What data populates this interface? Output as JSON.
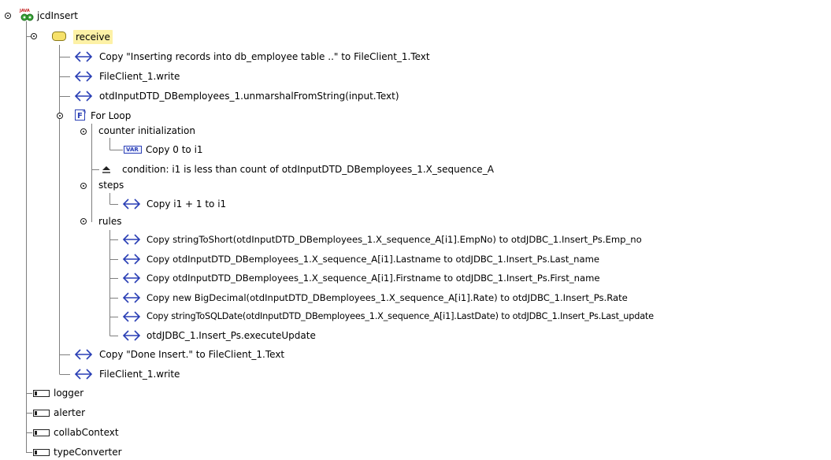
{
  "colors": {
    "tree_line": "#7f7f7f",
    "arrow_icon": "#2a3fb5",
    "folder_icon": "#f6e16a",
    "receive_highlight": "#fdf1a6"
  },
  "tree": {
    "root": {
      "label": "jcdInsert",
      "icon": "java-gear-icon"
    },
    "receive": {
      "label": "receive",
      "icon": "folder-icon"
    },
    "items": [
      {
        "label": "Copy \"Inserting records into db_employee table ..\" to FileClient_1.Text",
        "icon": "arrow-icon"
      },
      {
        "label": "FileClient_1.write",
        "icon": "arrow-icon"
      },
      {
        "label": "otdInputDTD_DBemployees_1.unmarshalFromString(input.Text)",
        "icon": "arrow-icon"
      }
    ],
    "for_loop": {
      "label": "For Loop",
      "icon": "for-loop-icon"
    },
    "counter_init": {
      "label": "counter initialization",
      "child": {
        "label": "Copy 0 to i1",
        "icon_text": "VAR"
      }
    },
    "condition": {
      "label": "condition: i1 is less than count of otdInputDTD_DBemployees_1.X_sequence_A",
      "icon": "condition-icon"
    },
    "steps": {
      "label": "steps",
      "child": {
        "label": "Copy i1 + 1 to i1",
        "icon": "arrow-icon"
      }
    },
    "rules": {
      "label": "rules",
      "children": [
        {
          "label": "Copy stringToShort(otdInputDTD_DBemployees_1.X_sequence_A[i1].EmpNo) to otdJDBC_1.Insert_Ps.Emp_no"
        },
        {
          "label": "Copy otdInputDTD_DBemployees_1.X_sequence_A[i1].Lastname to otdJDBC_1.Insert_Ps.Last_name"
        },
        {
          "label": "Copy otdInputDTD_DBemployees_1.X_sequence_A[i1].Firstname to otdJDBC_1.Insert_Ps.First_name"
        },
        {
          "label": "Copy new BigDecimal(otdInputDTD_DBemployees_1.X_sequence_A[i1].Rate) to otdJDBC_1.Insert_Ps.Rate"
        },
        {
          "label": "Copy stringToSQLDate(otdInputDTD_DBemployees_1.X_sequence_A[i1].LastDate) to otdJDBC_1.Insert_Ps.Last_update"
        },
        {
          "label": "otdJDBC_1.Insert_Ps.executeUpdate"
        }
      ]
    },
    "after_loop": [
      {
        "label": "Copy \"Done Insert.\" to FileClient_1.Text",
        "icon": "arrow-icon"
      },
      {
        "label": "FileClient_1.write",
        "icon": "arrow-icon"
      }
    ],
    "fields": [
      {
        "label": "logger",
        "icon": "field-icon"
      },
      {
        "label": "alerter",
        "icon": "field-icon"
      },
      {
        "label": "collabContext",
        "icon": "field-icon"
      },
      {
        "label": "typeConverter",
        "icon": "field-icon"
      }
    ]
  }
}
